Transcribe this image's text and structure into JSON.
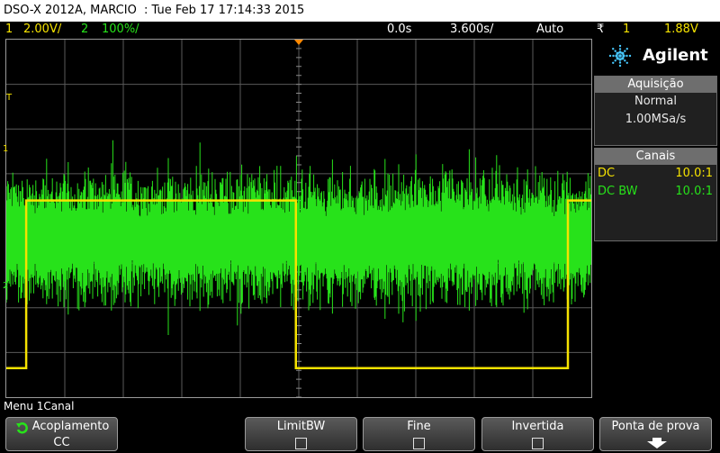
{
  "title_bar": {
    "model": "DSO-X 2012A, MARCIO",
    "datetime": ": Tue Feb 17 17:14:33 2015"
  },
  "status": {
    "ch1_num": "1",
    "ch1_scale": "2.00V/",
    "ch2_num": "2",
    "ch2_scale": "100%/",
    "time_offset": "0.0s",
    "time_scale": "3.600s/",
    "trigger_mode": "Auto",
    "trigger_symbol": "₹",
    "trigger_source": "1",
    "trigger_level": "1.88V"
  },
  "markers": {
    "trigger": "T",
    "ch1": "1",
    "ch2": "2"
  },
  "panel": {
    "brand": "Agilent",
    "acq_header": "Aquisição",
    "acq_mode": "Normal",
    "acq_rate": "1.00MSa/s",
    "ch_header": "Canais",
    "ch1_coupling": "DC",
    "ch1_probe": "10.0:1",
    "ch2_coupling": "DC BW",
    "ch2_probe": "10.0:1"
  },
  "menu": {
    "title": "Menu 1Canal",
    "coupling_label": "Acoplamento",
    "coupling_value": "CC",
    "limitbw_label": "LimitBW",
    "fine_label": "Fine",
    "invert_label": "Invertida",
    "probe_label": "Ponta de prova"
  },
  "colors": {
    "ch1": "#f5e200",
    "ch2": "#27e21a",
    "grid": "#5a5a5a",
    "accent_icon": "#47c8ff"
  },
  "chart_data": {
    "type": "line",
    "series": [
      {
        "channel": "1",
        "color": "#f5e200",
        "shape": "square wave",
        "levels_div": [
          -3.35,
          0.4
        ],
        "transitions_div": [
          0.34,
          4.95,
          9.6
        ]
      },
      {
        "channel": "2",
        "color": "#27e21a",
        "shape": "dense noise envelope",
        "center_div": -0.45,
        "amplitude_div": 1.7
      }
    ],
    "x_divisions": 10,
    "y_divisions": 8,
    "grid": true
  }
}
